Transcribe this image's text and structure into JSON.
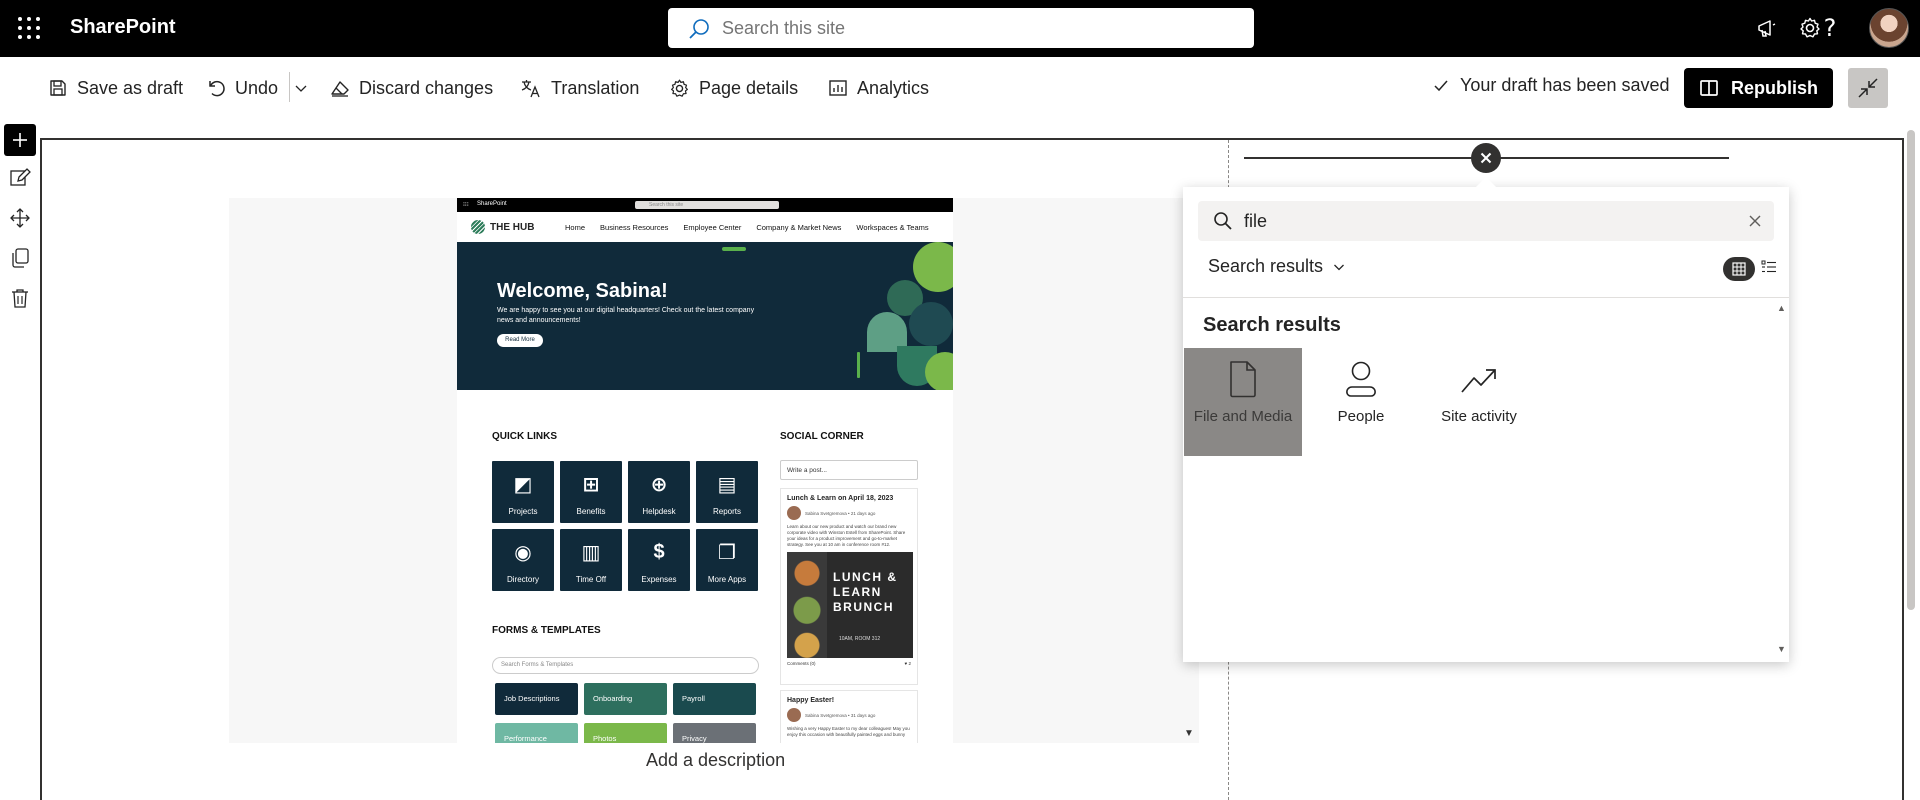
{
  "suite": {
    "app_name": "SharePoint",
    "search_placeholder": "Search this site",
    "icons": [
      "waffle-icon",
      "megaphone-icon",
      "gear-icon",
      "help-icon",
      "avatar"
    ]
  },
  "command_bar": {
    "save_as_draft": "Save as draft",
    "undo": "Undo",
    "discard": "Discard changes",
    "translation": "Translation",
    "page_details": "Page details",
    "analytics": "Analytics",
    "saved_status": "Your draft has been saved",
    "republish": "Republish"
  },
  "canvas": {
    "add_description": "Add a description"
  },
  "preview": {
    "suite_name": "SharePoint",
    "search": "Search this site",
    "logo": "THE HUB",
    "nav": [
      "Home",
      "Business Resources",
      "Employee Center",
      "Company & Market News",
      "Workspaces & Teams"
    ],
    "hero_title": "Welcome, Sabina!",
    "hero_text": "We are happy to see you at our digital headquarters! Check out the latest company news and announcements!",
    "hero_button": "Read More",
    "quick_links_title": "QUICK LINKS",
    "quick_links": [
      "Projects",
      "Benefits",
      "Helpdesk",
      "Reports",
      "Directory",
      "Time Off",
      "Expenses",
      "More Apps"
    ],
    "forms_title": "FORMS & TEMPLATES",
    "forms_search": "Search Forms & Templates",
    "forms": [
      "Job Descriptions",
      "Onboarding",
      "Payroll",
      "Performance",
      "Photos",
      "Privacy"
    ],
    "social_title": "SOCIAL CORNER",
    "write_post": "Write a post...",
    "post1_title": "Lunch & Learn on April 18, 2023",
    "post1_author": "Sabina Svetgremova • 21 days ago",
    "post1_text": "Learn about our new product and watch our brand new corporate video with Winston Estell from SharePoint. Share your ideas for a product improvement and go-to-market strategy. See you at 10 am in conference room #12.",
    "post1_image_text": "LUNCH & LEARN BRUNCH",
    "post1_image_small": "10AM, ROOM 312",
    "post1_comments": "Comments (0)",
    "post1_likes": "2",
    "post2_title": "Happy Easter!",
    "post2_author": "Sabina Svetgremova • 31 days ago",
    "post2_text": "Wishing a very Happy Easter to my dear colleagues! May you enjoy this occasion with beautifully painted eggs and bunny"
  },
  "search_panel": {
    "query": "file",
    "scope": "Search results",
    "results_heading": "Search results",
    "tiles": [
      {
        "label": "File and Media",
        "icon": "file-icon",
        "selected": true
      },
      {
        "label": "People",
        "icon": "person-icon",
        "selected": false
      },
      {
        "label": "Site activity",
        "icon": "trending-icon",
        "selected": false
      }
    ]
  }
}
